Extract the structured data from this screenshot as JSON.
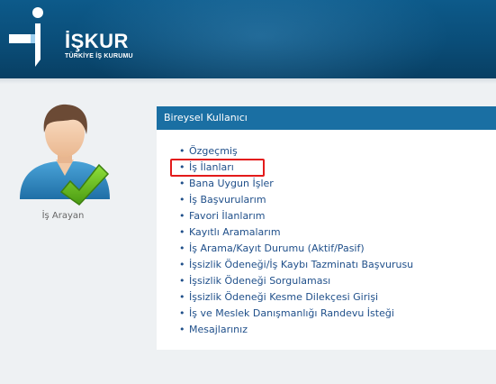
{
  "header": {
    "logo_text": "İŞKUR",
    "logo_subtitle": "TÜRKİYE İŞ KURUMU",
    "logo_icon": "iskur-logo-icon"
  },
  "colors": {
    "header_bg": "#0a4d78",
    "panel_header_bg": "#1a6fa3",
    "link": "#1f4f8a",
    "highlight": "#e31b1b",
    "checkmark": "#6cc024"
  },
  "user": {
    "role_label": "İş Arayan",
    "avatar_icon": "user-avatar-checkmark-icon"
  },
  "panel": {
    "title": "Bireysel Kullanıcı",
    "items": [
      {
        "label": "Özgeçmiş"
      },
      {
        "label": "İş İlanları"
      },
      {
        "label": "Bana Uygun İşler"
      },
      {
        "label": "İş Başvurularım"
      },
      {
        "label": "Favori İlanlarım"
      },
      {
        "label": "Kayıtlı Aramalarım"
      },
      {
        "label": "İş Arama/Kayıt Durumu (Aktif/Pasif)"
      },
      {
        "label": "İşsizlik Ödeneği/İş Kaybı Tazminatı Başvurusu"
      },
      {
        "label": "İşsizlik Ödeneği Sorgulaması"
      },
      {
        "label": "İşsizlik Ödeneği Kesme Dilekçesi Girişi"
      },
      {
        "label": "İş ve Meslek Danışmanlığı Randevu İsteği"
      },
      {
        "label": "Mesajlarınız"
      }
    ]
  }
}
